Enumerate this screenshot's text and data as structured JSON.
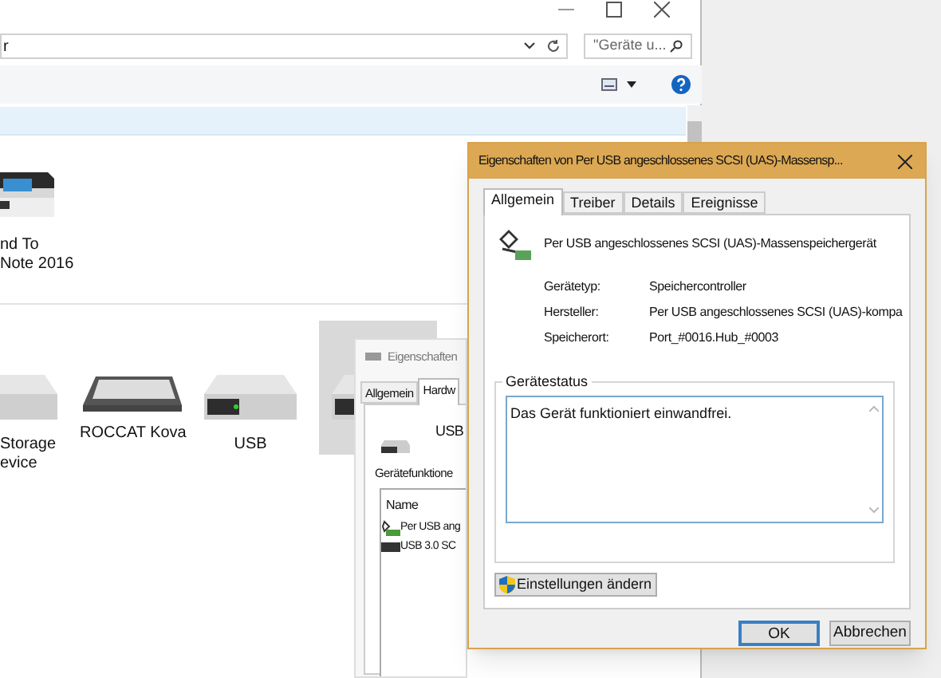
{
  "explorer": {
    "address": "r",
    "search": {
      "placeholder": "\"Geräte u..."
    },
    "devices": [
      {
        "kind": "printer",
        "label": "nd To\nNote 2016",
        "selected": false
      },
      {
        "kind": "drive",
        "label": "Storage\nevice",
        "selected": false
      },
      {
        "kind": "keyboard",
        "label": "ROCCAT Kova",
        "selected": false
      },
      {
        "kind": "drive",
        "label": "USB",
        "selected": false
      },
      {
        "kind": "drive",
        "selected": true
      }
    ]
  },
  "back_dialog": {
    "title": "Eigenschaften",
    "tabs": [
      {
        "label": "Allgemein",
        "selected": false
      },
      {
        "label": "Hardw",
        "selected": true
      }
    ],
    "device": "USB",
    "functions_label": "Gerätefunktione",
    "column": "Name",
    "rows": [
      {
        "kind": "controller",
        "name": "Per USB ang"
      },
      {
        "kind": "drive",
        "name": "USB 3.0 SC"
      }
    ]
  },
  "dialog": {
    "title": "Eigenschaften von Per USB angeschlossenes SCSI (UAS)-Massensp...",
    "tabs": [
      {
        "label": "Allgemein",
        "selected": true
      },
      {
        "label": "Treiber",
        "selected": false
      },
      {
        "label": "Details",
        "selected": false
      },
      {
        "label": "Ereignisse",
        "selected": false
      }
    ],
    "device_name": "Per USB angeschlossenes SCSI (UAS)-Massenspeichergerät",
    "properties": [
      {
        "label": "Gerätetyp:",
        "value": "Speichercontroller"
      },
      {
        "label": "Hersteller:",
        "value": "Per USB angeschlossenes SCSI (UAS)-kompa"
      },
      {
        "label": "Speicherort:",
        "value": "Port_#0016.Hub_#0003"
      }
    ],
    "status_group": "Gerätestatus",
    "status_text": "Das Gerät funktioniert einwandfrei.",
    "change_button": "Einstellungen ändern",
    "buttons": [
      {
        "label": "OK",
        "kind": "default"
      },
      {
        "label": "Abbrechen",
        "kind": "normal"
      }
    ]
  }
}
